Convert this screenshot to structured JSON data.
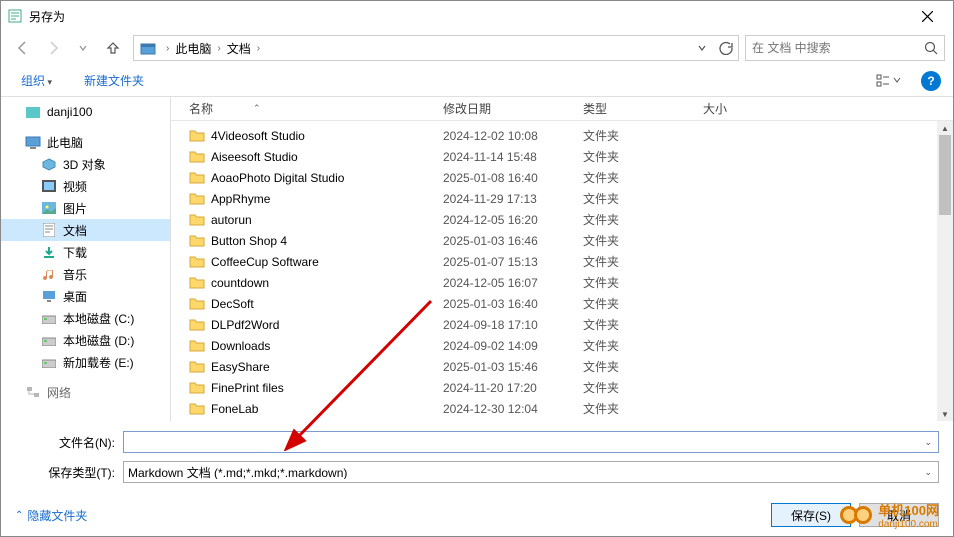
{
  "window": {
    "title": "另存为"
  },
  "breadcrumb": {
    "items": [
      "此电脑",
      "文档"
    ]
  },
  "search": {
    "placeholder": "在 文档 中搜索"
  },
  "toolbar": {
    "organize": "组织",
    "new_folder": "新建文件夹"
  },
  "sidebar": {
    "quick": {
      "label": "danji100"
    },
    "pc": {
      "label": "此电脑"
    },
    "items": [
      {
        "label": "3D 对象"
      },
      {
        "label": "视频"
      },
      {
        "label": "图片"
      },
      {
        "label": "文档",
        "selected": true
      },
      {
        "label": "下载"
      },
      {
        "label": "音乐"
      },
      {
        "label": "桌面"
      },
      {
        "label": "本地磁盘 (C:)"
      },
      {
        "label": "本地磁盘 (D:)"
      },
      {
        "label": "新加载卷 (E:)"
      }
    ],
    "network": {
      "label": "网络"
    }
  },
  "columns": {
    "name": "名称",
    "date": "修改日期",
    "type": "类型",
    "size": "大小"
  },
  "files": [
    {
      "name": "4Videosoft Studio",
      "date": "2024-12-02 10:08",
      "type": "文件夹"
    },
    {
      "name": "Aiseesoft Studio",
      "date": "2024-11-14 15:48",
      "type": "文件夹"
    },
    {
      "name": "AoaoPhoto Digital Studio",
      "date": "2025-01-08 16:40",
      "type": "文件夹"
    },
    {
      "name": "AppRhyme",
      "date": "2024-11-29 17:13",
      "type": "文件夹"
    },
    {
      "name": "autorun",
      "date": "2024-12-05 16:20",
      "type": "文件夹"
    },
    {
      "name": "Button Shop 4",
      "date": "2025-01-03 16:46",
      "type": "文件夹"
    },
    {
      "name": "CoffeeCup Software",
      "date": "2025-01-07 15:13",
      "type": "文件夹"
    },
    {
      "name": "countdown",
      "date": "2024-12-05 16:07",
      "type": "文件夹"
    },
    {
      "name": "DecSoft",
      "date": "2025-01-03 16:40",
      "type": "文件夹"
    },
    {
      "name": "DLPdf2Word",
      "date": "2024-09-18 17:10",
      "type": "文件夹"
    },
    {
      "name": "Downloads",
      "date": "2024-09-02 14:09",
      "type": "文件夹"
    },
    {
      "name": "EasyShare",
      "date": "2025-01-03 15:46",
      "type": "文件夹"
    },
    {
      "name": "FinePrint files",
      "date": "2024-11-20 17:20",
      "type": "文件夹"
    },
    {
      "name": "FoneLab",
      "date": "2024-12-30 12:04",
      "type": "文件夹"
    }
  ],
  "form": {
    "filename_label": "文件名(N):",
    "filename_value": "",
    "filetype_label": "保存类型(T):",
    "filetype_value": "Markdown 文档 (*.md;*.mkd;*.markdown)"
  },
  "footer": {
    "hide_folders": "隐藏文件夹",
    "save": "保存(S)",
    "cancel": "取消"
  },
  "watermark": {
    "brand": "单机100网",
    "url": "danji100.com"
  }
}
